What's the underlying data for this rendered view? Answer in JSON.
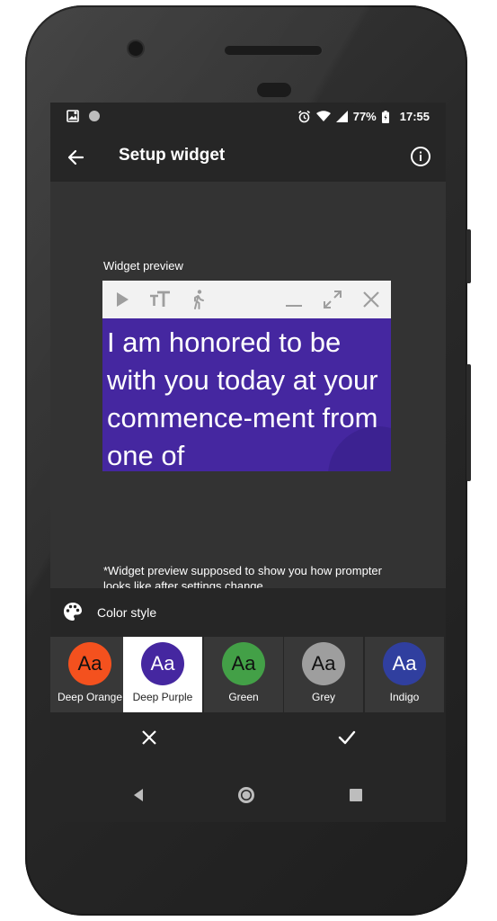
{
  "status_bar": {
    "left_icons": [
      "photo-notification-icon",
      "dot-notification-icon"
    ],
    "right_icons": [
      "alarm-icon",
      "wifi-icon",
      "signal-icon",
      "battery-icon"
    ],
    "battery": "77%",
    "time": "17:55"
  },
  "toolbar": {
    "title": "Setup widget",
    "back_icon": "arrow-back-icon",
    "info_icon": "info-icon"
  },
  "preview": {
    "label": "Widget preview",
    "widget_toolbar_icons": [
      "play-icon",
      "text-size-icon",
      "walk-icon",
      "minimize-icon",
      "expand-icon",
      "close-icon"
    ],
    "text": "I am honored to be with you today at your commence-ment from one of",
    "background": "#4527a0",
    "note": "*Widget preview supposed to show you how prompter looks like after settings change."
  },
  "color_style": {
    "label": "Color style",
    "icon": "palette-icon",
    "swatches": [
      {
        "name": "Deep Orange",
        "glyph": "Aa",
        "color": "#f4511e",
        "selected": false
      },
      {
        "name": "Deep Purple",
        "glyph": "Aa",
        "color": "#4527a0",
        "selected": true
      },
      {
        "name": "Green",
        "glyph": "Aa",
        "color": "#43a047",
        "selected": false
      },
      {
        "name": "Grey",
        "glyph": "Aa",
        "color": "#9e9e9e",
        "selected": false
      },
      {
        "name": "Indigo",
        "glyph": "Aa",
        "color": "#303f9f",
        "selected": false
      }
    ]
  },
  "actions": {
    "cancel_icon": "close-icon",
    "confirm_icon": "check-icon"
  },
  "navbar": {
    "icons": [
      "nav-back-icon",
      "nav-home-icon",
      "nav-recents-icon"
    ]
  }
}
